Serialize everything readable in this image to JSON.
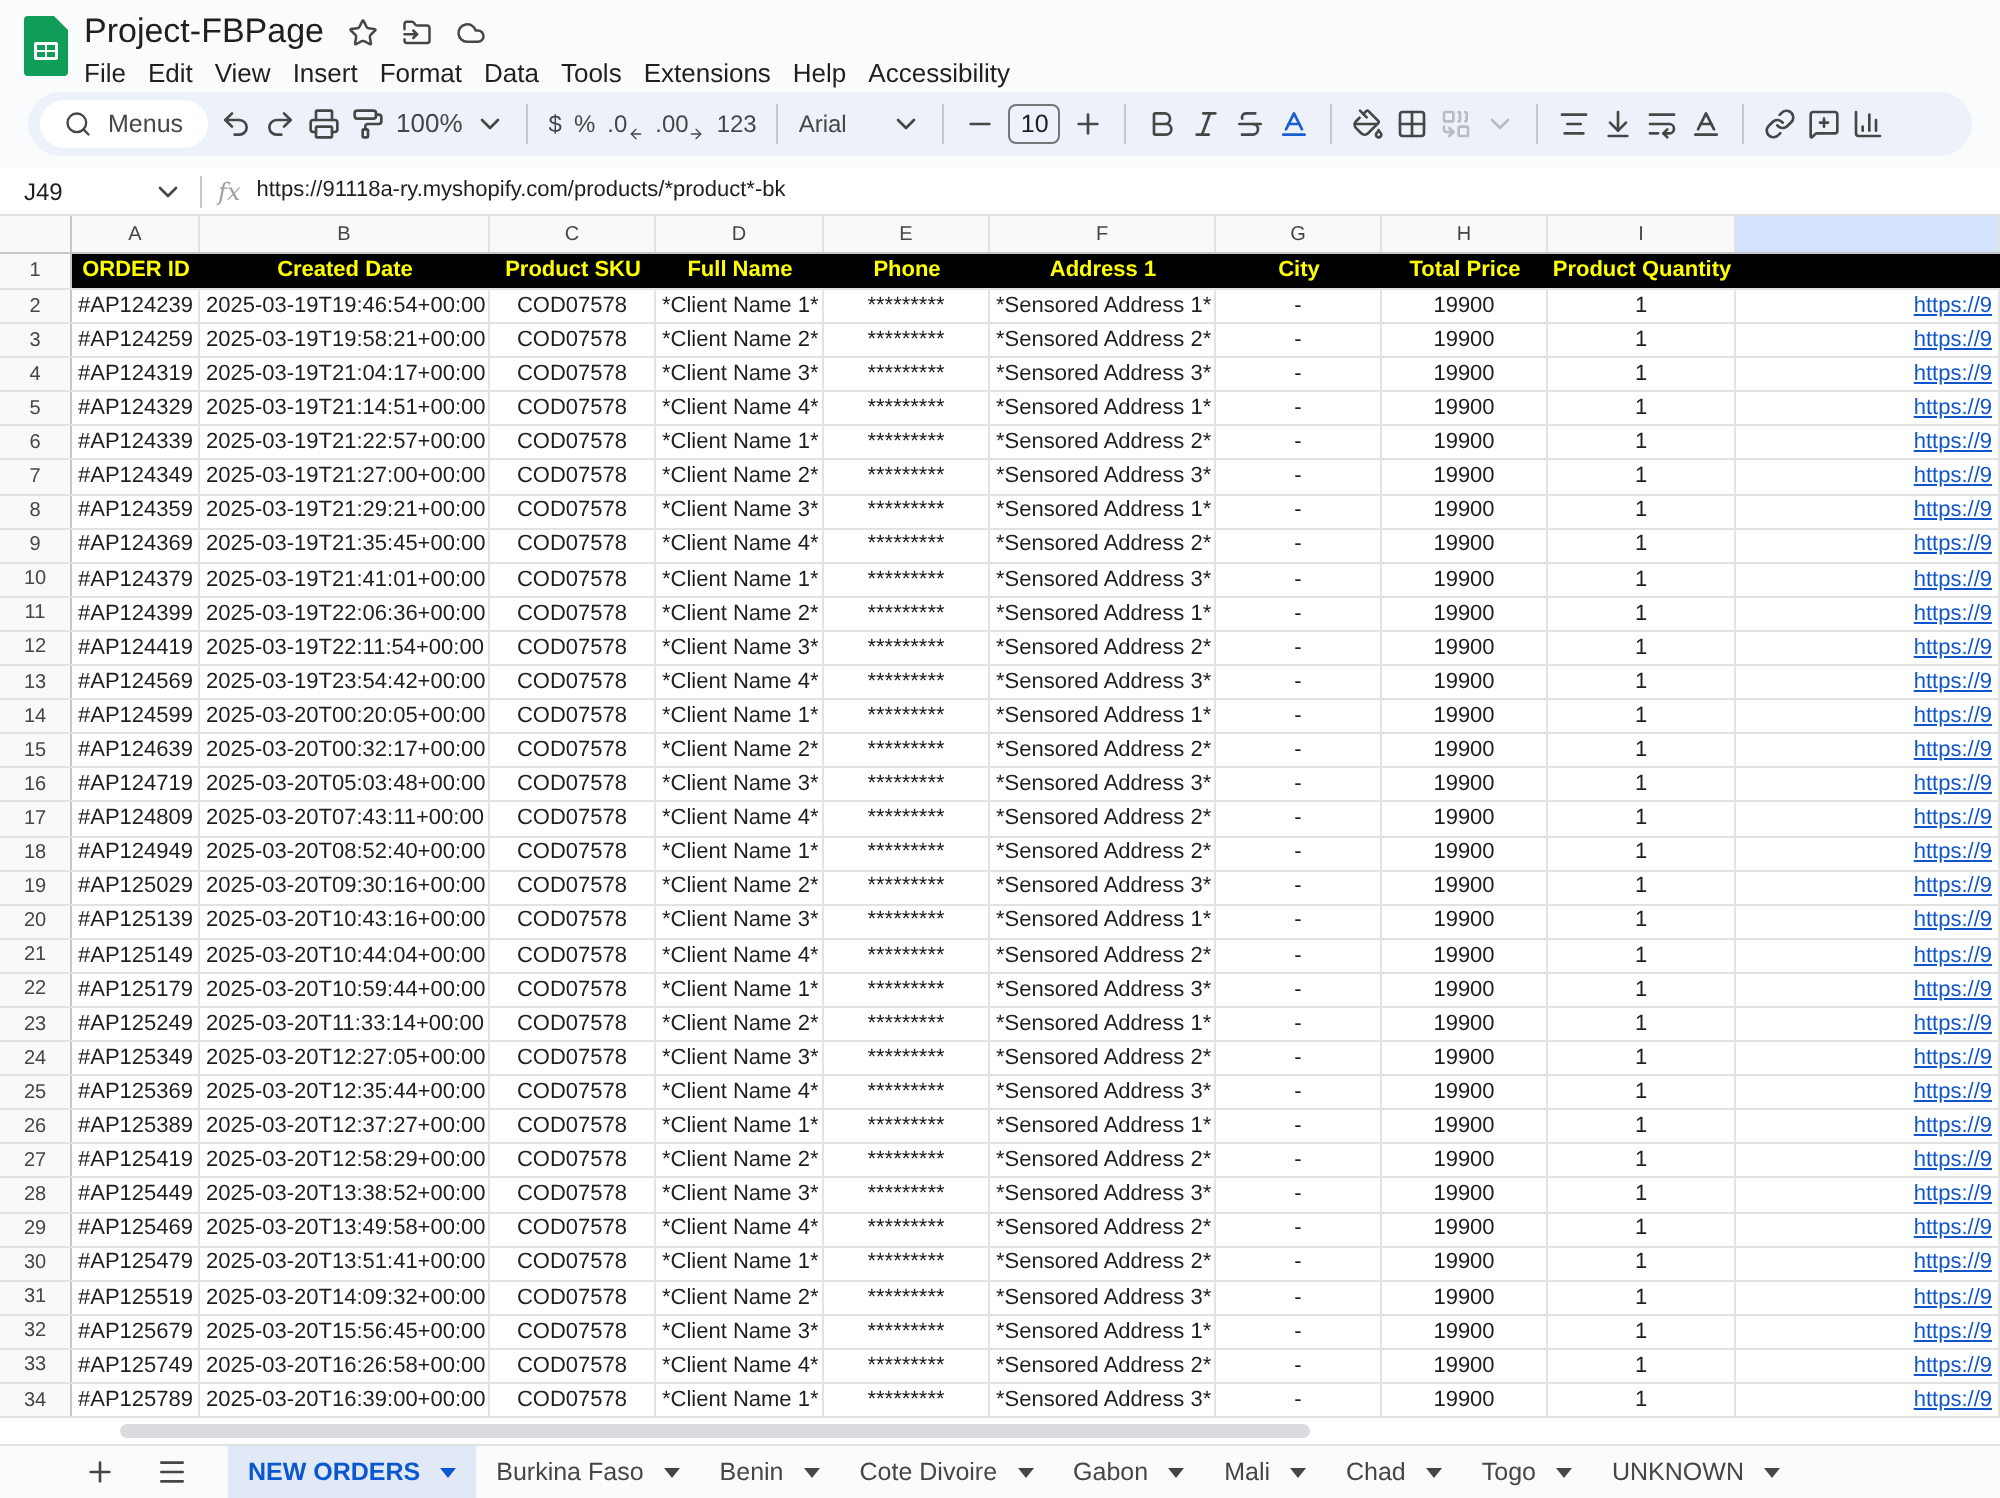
{
  "document": {
    "title": "Project-FBPage"
  },
  "menu": [
    "File",
    "Edit",
    "View",
    "Insert",
    "Format",
    "Data",
    "Tools",
    "Extensions",
    "Help",
    "Accessibility"
  ],
  "toolbar": {
    "search_placeholder": "Menus",
    "zoom": "100%",
    "currency": "$",
    "percent": "%",
    "decrease_decimals": ".0",
    "increase_decimals": ".00",
    "number_format": "123",
    "font": "Arial",
    "font_size": "10"
  },
  "formula_bar": {
    "cell_ref": "J49",
    "fx": "fx",
    "formula": "https://91118a-ry.myshopify.com/products/*product*-bk"
  },
  "columns": [
    {
      "letter": "A",
      "selected": false
    },
    {
      "letter": "B",
      "selected": false
    },
    {
      "letter": "C",
      "selected": false
    },
    {
      "letter": "D",
      "selected": false
    },
    {
      "letter": "E",
      "selected": false
    },
    {
      "letter": "F",
      "selected": false
    },
    {
      "letter": "G",
      "selected": false
    },
    {
      "letter": "H",
      "selected": false
    },
    {
      "letter": "I",
      "selected": false
    },
    {
      "selected": true
    }
  ],
  "header_row": {
    "number": "1",
    "cells": [
      "ORDER ID",
      "Created Date",
      "Product SKU",
      "Full Name",
      "Phone",
      "Address 1",
      "City",
      "Total Price",
      "Product Quantity"
    ]
  },
  "rows": [
    {
      "number": "2",
      "cells": [
        "#AP124239",
        "2025-03-19T19:46:54+00:00",
        "COD07578",
        "*Client Name 1*",
        "*********",
        "*Sensored Address 1*",
        "-",
        "19900",
        "1",
        "https://9"
      ]
    },
    {
      "number": "3",
      "cells": [
        "#AP124259",
        "2025-03-19T19:58:21+00:00",
        "COD07578",
        "*Client Name 2*",
        "*********",
        "*Sensored Address 2*",
        "-",
        "19900",
        "1",
        "https://9"
      ]
    },
    {
      "number": "4",
      "cells": [
        "#AP124319",
        "2025-03-19T21:04:17+00:00",
        "COD07578",
        "*Client Name 3*",
        "*********",
        "*Sensored Address 3*",
        "-",
        "19900",
        "1",
        "https://9"
      ]
    },
    {
      "number": "5",
      "cells": [
        "#AP124329",
        "2025-03-19T21:14:51+00:00",
        "COD07578",
        "*Client Name 4*",
        "*********",
        "*Sensored Address 1*",
        "-",
        "19900",
        "1",
        "https://9"
      ]
    },
    {
      "number": "6",
      "cells": [
        "#AP124339",
        "2025-03-19T21:22:57+00:00",
        "COD07578",
        "*Client Name 1*",
        "*********",
        "*Sensored Address 2*",
        "-",
        "19900",
        "1",
        "https://9"
      ]
    },
    {
      "number": "7",
      "cells": [
        "#AP124349",
        "2025-03-19T21:27:00+00:00",
        "COD07578",
        "*Client Name 2*",
        "*********",
        "*Sensored Address 3*",
        "-",
        "19900",
        "1",
        "https://9"
      ]
    },
    {
      "number": "8",
      "cells": [
        "#AP124359",
        "2025-03-19T21:29:21+00:00",
        "COD07578",
        "*Client Name 3*",
        "*********",
        "*Sensored Address 1*",
        "-",
        "19900",
        "1",
        "https://9"
      ]
    },
    {
      "number": "9",
      "cells": [
        "#AP124369",
        "2025-03-19T21:35:45+00:00",
        "COD07578",
        "*Client Name 4*",
        "*********",
        "*Sensored Address 2*",
        "-",
        "19900",
        "1",
        "https://9"
      ]
    },
    {
      "number": "10",
      "cells": [
        "#AP124379",
        "2025-03-19T21:41:01+00:00",
        "COD07578",
        "*Client Name 1*",
        "*********",
        "*Sensored Address 3*",
        "-",
        "19900",
        "1",
        "https://9"
      ]
    },
    {
      "number": "11",
      "cells": [
        "#AP124399",
        "2025-03-19T22:06:36+00:00",
        "COD07578",
        "*Client Name 2*",
        "*********",
        "*Sensored Address 1*",
        "-",
        "19900",
        "1",
        "https://9"
      ]
    },
    {
      "number": "12",
      "cells": [
        "#AP124419",
        "2025-03-19T22:11:54+00:00",
        "COD07578",
        "*Client Name 3*",
        "*********",
        "*Sensored Address 2*",
        "-",
        "19900",
        "1",
        "https://9"
      ]
    },
    {
      "number": "13",
      "cells": [
        "#AP124569",
        "2025-03-19T23:54:42+00:00",
        "COD07578",
        "*Client Name 4*",
        "*********",
        "*Sensored Address 3*",
        "-",
        "19900",
        "1",
        "https://9"
      ]
    },
    {
      "number": "14",
      "cells": [
        "#AP124599",
        "2025-03-20T00:20:05+00:00",
        "COD07578",
        "*Client Name 1*",
        "*********",
        "*Sensored Address 1*",
        "-",
        "19900",
        "1",
        "https://9"
      ]
    },
    {
      "number": "15",
      "cells": [
        "#AP124639",
        "2025-03-20T00:32:17+00:00",
        "COD07578",
        "*Client Name 2*",
        "*********",
        "*Sensored Address 2*",
        "-",
        "19900",
        "1",
        "https://9"
      ]
    },
    {
      "number": "16",
      "cells": [
        "#AP124719",
        "2025-03-20T05:03:48+00:00",
        "COD07578",
        "*Client Name 3*",
        "*********",
        "*Sensored Address 3*",
        "-",
        "19900",
        "1",
        "https://9"
      ]
    },
    {
      "number": "17",
      "cells": [
        "#AP124809",
        "2025-03-20T07:43:11+00:00",
        "COD07578",
        "*Client Name 4*",
        "*********",
        "*Sensored Address 2*",
        "-",
        "19900",
        "1",
        "https://9"
      ]
    },
    {
      "number": "18",
      "cells": [
        "#AP124949",
        "2025-03-20T08:52:40+00:00",
        "COD07578",
        "*Client Name 1*",
        "*********",
        "*Sensored Address 2*",
        "-",
        "19900",
        "1",
        "https://9"
      ]
    },
    {
      "number": "19",
      "cells": [
        "#AP125029",
        "2025-03-20T09:30:16+00:00",
        "COD07578",
        "*Client Name 2*",
        "*********",
        "*Sensored Address 3*",
        "-",
        "19900",
        "1",
        "https://9"
      ]
    },
    {
      "number": "20",
      "cells": [
        "#AP125139",
        "2025-03-20T10:43:16+00:00",
        "COD07578",
        "*Client Name 3*",
        "*********",
        "*Sensored Address 1*",
        "-",
        "19900",
        "1",
        "https://9"
      ]
    },
    {
      "number": "21",
      "cells": [
        "#AP125149",
        "2025-03-20T10:44:04+00:00",
        "COD07578",
        "*Client Name 4*",
        "*********",
        "*Sensored Address 2*",
        "-",
        "19900",
        "1",
        "https://9"
      ]
    },
    {
      "number": "22",
      "cells": [
        "#AP125179",
        "2025-03-20T10:59:44+00:00",
        "COD07578",
        "*Client Name 1*",
        "*********",
        "*Sensored Address 3*",
        "-",
        "19900",
        "1",
        "https://9"
      ]
    },
    {
      "number": "23",
      "cells": [
        "#AP125249",
        "2025-03-20T11:33:14+00:00",
        "COD07578",
        "*Client Name 2*",
        "*********",
        "*Sensored Address 1*",
        "-",
        "19900",
        "1",
        "https://9"
      ]
    },
    {
      "number": "24",
      "cells": [
        "#AP125349",
        "2025-03-20T12:27:05+00:00",
        "COD07578",
        "*Client Name 3*",
        "*********",
        "*Sensored Address 2*",
        "-",
        "19900",
        "1",
        "https://9"
      ]
    },
    {
      "number": "25",
      "cells": [
        "#AP125369",
        "2025-03-20T12:35:44+00:00",
        "COD07578",
        "*Client Name 4*",
        "*********",
        "*Sensored Address 3*",
        "-",
        "19900",
        "1",
        "https://9"
      ]
    },
    {
      "number": "26",
      "cells": [
        "#AP125389",
        "2025-03-20T12:37:27+00:00",
        "COD07578",
        "*Client Name 1*",
        "*********",
        "*Sensored Address 1*",
        "-",
        "19900",
        "1",
        "https://9"
      ]
    },
    {
      "number": "27",
      "cells": [
        "#AP125419",
        "2025-03-20T12:58:29+00:00",
        "COD07578",
        "*Client Name 2*",
        "*********",
        "*Sensored Address 2*",
        "-",
        "19900",
        "1",
        "https://9"
      ]
    },
    {
      "number": "28",
      "cells": [
        "#AP125449",
        "2025-03-20T13:38:52+00:00",
        "COD07578",
        "*Client Name 3*",
        "*********",
        "*Sensored Address 3*",
        "-",
        "19900",
        "1",
        "https://9"
      ]
    },
    {
      "number": "29",
      "cells": [
        "#AP125469",
        "2025-03-20T13:49:58+00:00",
        "COD07578",
        "*Client Name 4*",
        "*********",
        "*Sensored Address 2*",
        "-",
        "19900",
        "1",
        "https://9"
      ]
    },
    {
      "number": "30",
      "cells": [
        "#AP125479",
        "2025-03-20T13:51:41+00:00",
        "COD07578",
        "*Client Name 1*",
        "*********",
        "*Sensored Address 2*",
        "-",
        "19900",
        "1",
        "https://9"
      ]
    },
    {
      "number": "31",
      "cells": [
        "#AP125519",
        "2025-03-20T14:09:32+00:00",
        "COD07578",
        "*Client Name 2*",
        "*********",
        "*Sensored Address 3*",
        "-",
        "19900",
        "1",
        "https://9"
      ]
    },
    {
      "number": "32",
      "cells": [
        "#AP125679",
        "2025-03-20T15:56:45+00:00",
        "COD07578",
        "*Client Name 3*",
        "*********",
        "*Sensored Address 1*",
        "-",
        "19900",
        "1",
        "https://9"
      ]
    },
    {
      "number": "33",
      "cells": [
        "#AP125749",
        "2025-03-20T16:26:58+00:00",
        "COD07578",
        "*Client Name 4*",
        "*********",
        "*Sensored Address 2*",
        "-",
        "19900",
        "1",
        "https://9"
      ]
    },
    {
      "number": "34",
      "cells": [
        "#AP125789",
        "2025-03-20T16:39:00+00:00",
        "COD07578",
        "*Client Name 1*",
        "*********",
        "*Sensored Address 3*",
        "-",
        "19900",
        "1",
        "https://9"
      ]
    }
  ],
  "sheet_tabs": [
    {
      "label": "NEW ORDERS",
      "selected": true
    },
    {
      "label": "Burkina Faso",
      "selected": false
    },
    {
      "label": "Benin",
      "selected": false
    },
    {
      "label": "Cote Divoire",
      "selected": false
    },
    {
      "label": "Gabon",
      "selected": false
    },
    {
      "label": "Mali",
      "selected": false
    },
    {
      "label": "Chad",
      "selected": false
    },
    {
      "label": "Togo",
      "selected": false
    },
    {
      "label": "UNKNOWN",
      "selected": false
    }
  ]
}
